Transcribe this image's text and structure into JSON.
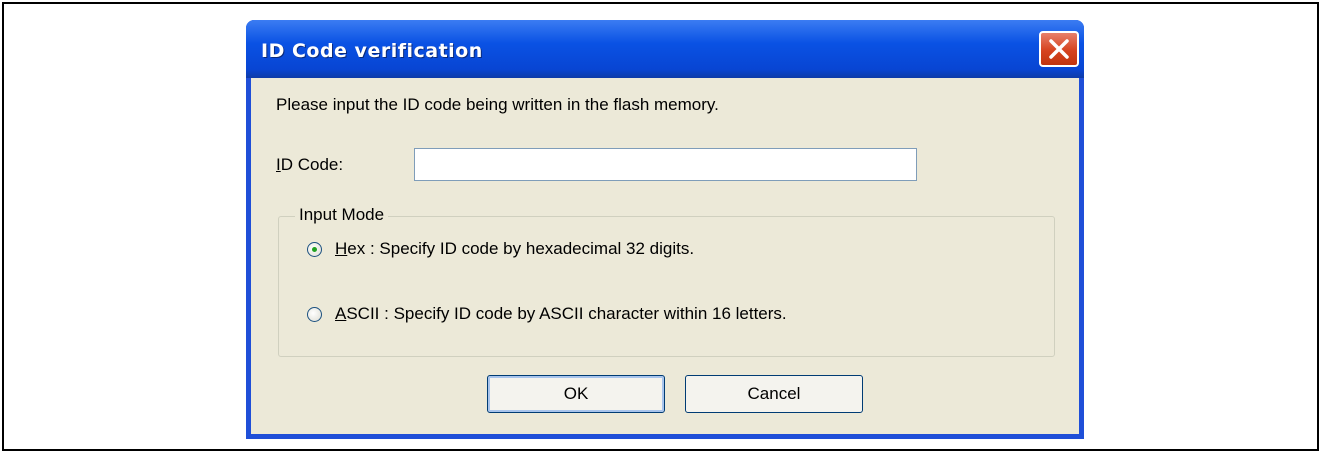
{
  "dialog": {
    "title": "ID Code verification",
    "prompt": "Please input the ID code being written in the flash memory.",
    "id_code_label_accel": "I",
    "id_code_label_rest": "D Code:",
    "id_code_value": "",
    "input_mode": {
      "title": "Input Mode",
      "options": [
        {
          "accel": "H",
          "label_rest": "ex : Specify ID code by hexadecimal 32 digits.",
          "checked": true
        },
        {
          "accel": "A",
          "label_rest": "SCII : Specify ID code by ASCII character within 16 letters.",
          "checked": false
        }
      ]
    },
    "ok_label": "OK",
    "cancel_label": "Cancel"
  },
  "colors": {
    "title_bar": "#0a52e4",
    "client_bg": "#ece9d8",
    "close_button": "#d6431f"
  },
  "icons": {
    "close": "close-icon"
  }
}
